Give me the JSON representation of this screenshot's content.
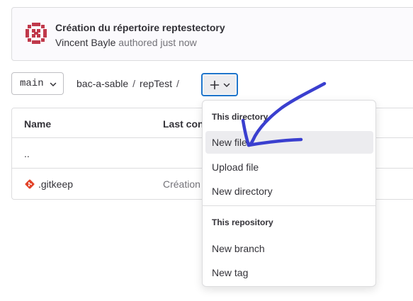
{
  "commit": {
    "title": "Création du répertoire reptestectory",
    "author": "Vincent Bayle",
    "time_text": "authored just now"
  },
  "branch": {
    "name": "main"
  },
  "breadcrumb": {
    "project": "bac-a-sable",
    "folder": "repTest",
    "separator": "/"
  },
  "table": {
    "headers": {
      "name": "Name",
      "last_commit": "Last con"
    },
    "rows": [
      {
        "name": "..",
        "last_commit": ""
      },
      {
        "name": ".gitkeep",
        "last_commit": "Création"
      }
    ]
  },
  "dropdown": {
    "sections": [
      {
        "header": "This directory",
        "items": [
          "New file",
          "Upload file",
          "New directory"
        ]
      },
      {
        "header": "This repository",
        "items": [
          "New branch",
          "New tag"
        ]
      }
    ],
    "highlighted_item": "New file"
  },
  "icons": {
    "avatar": "identicon-avatar",
    "branch_chevron": "chevron-down-icon",
    "add": "plus-icon",
    "add_chevron": "chevron-down-icon",
    "file": "git-file-icon"
  },
  "colors": {
    "focus_ring": "#1f75cb",
    "avatar": "#c0394b",
    "file_icon": "#e24329",
    "annotation": "#3a3fcf",
    "hover_bg": "#ececef"
  }
}
